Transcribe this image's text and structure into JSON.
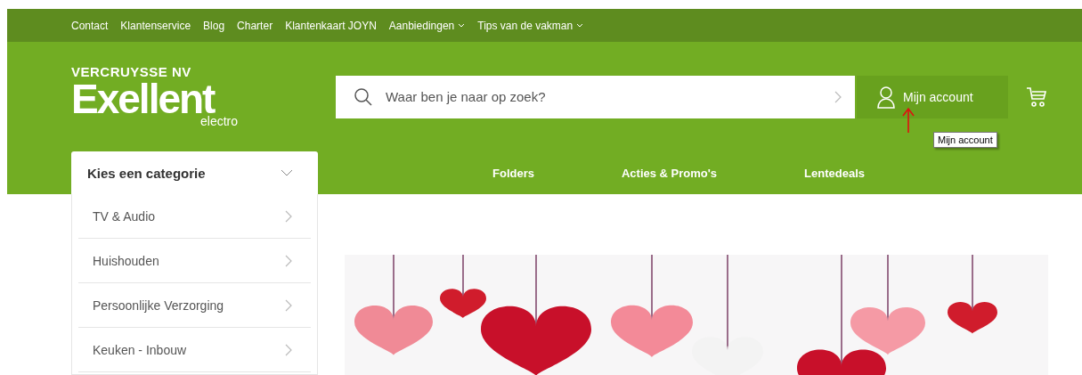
{
  "top_links": [
    {
      "label": "Contact",
      "dropdown": false
    },
    {
      "label": "Klantenservice",
      "dropdown": false
    },
    {
      "label": "Blog",
      "dropdown": false
    },
    {
      "label": "Charter",
      "dropdown": false
    },
    {
      "label": "Klantenkaart JOYN",
      "dropdown": false
    },
    {
      "label": "Aanbiedingen",
      "dropdown": true
    },
    {
      "label": "Tips van de vakman",
      "dropdown": true
    }
  ],
  "logo": {
    "company": "VERCRUYSSE NV",
    "brand": "Exellent",
    "sub": "electro"
  },
  "search": {
    "placeholder": "Waar ben je naar op zoek?"
  },
  "account": {
    "label": "Mijn account",
    "tooltip": "Mijn account"
  },
  "category_menu": {
    "title": "Kies een categorie",
    "items": [
      "TV & Audio",
      "Huishouden",
      "Persoonlijke Verzorging",
      "Keuken - Inbouw"
    ]
  },
  "nav": [
    "Folders",
    "Acties & Promo's",
    "Lentedeals"
  ]
}
